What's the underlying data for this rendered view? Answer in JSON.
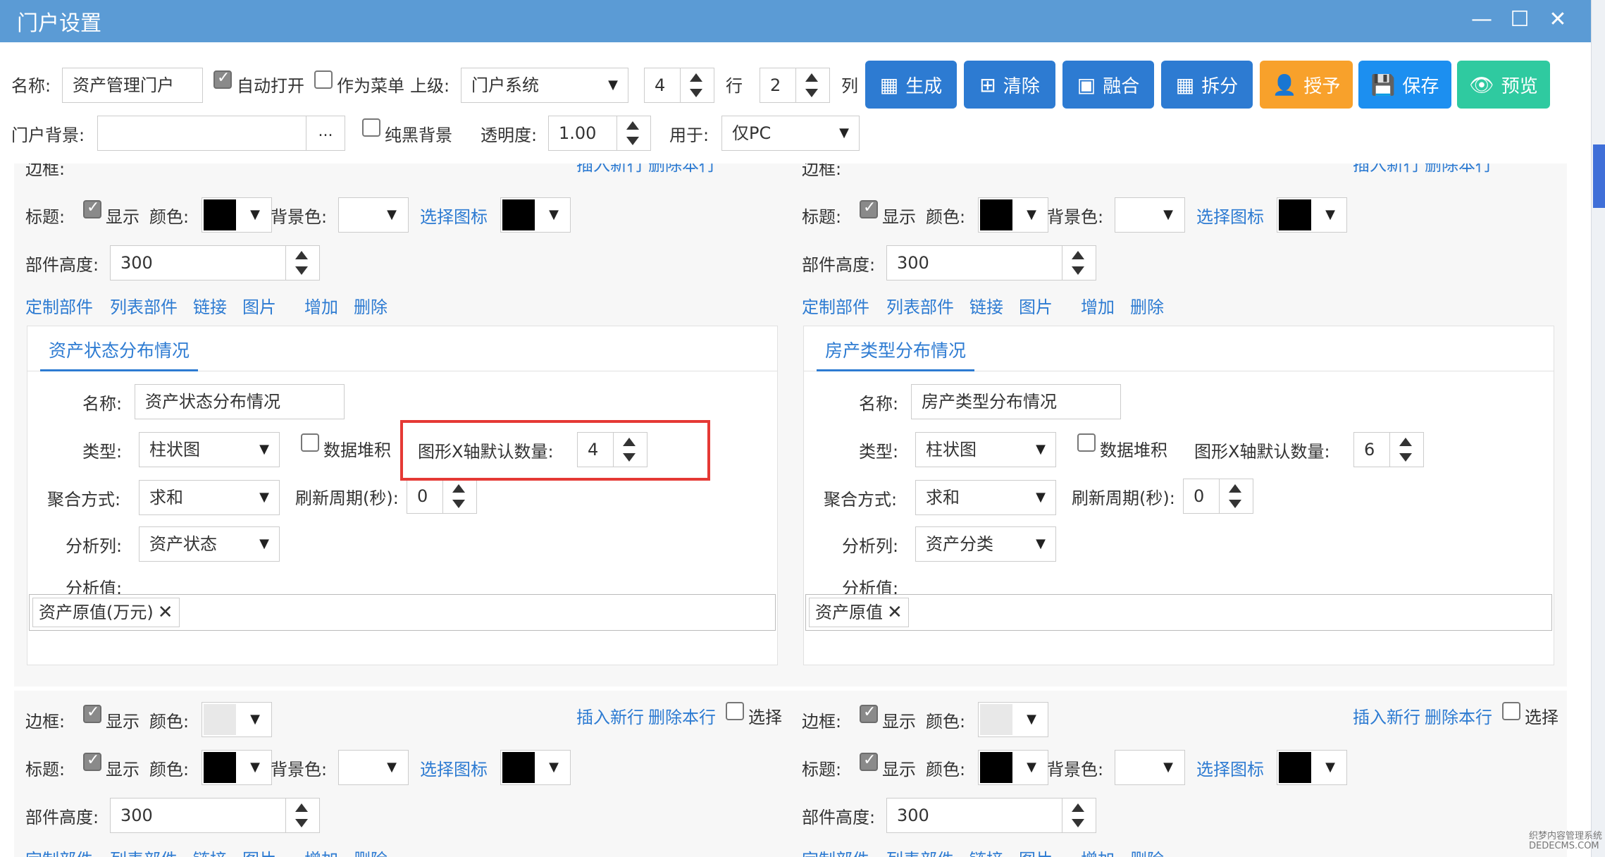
{
  "window": {
    "title": "门户设置",
    "minimize": "—",
    "maximize": "☐",
    "close": "✕"
  },
  "toolbar": {
    "name_label": "名称:",
    "name_value": "资产管理门户",
    "auto_open_label": "自动打开",
    "auto_open_checked": true,
    "as_menu_label": "作为菜单",
    "as_menu_checked": false,
    "parent_label": "上级:",
    "parent_value": "门户系统",
    "rows_value": "4",
    "rows_label": "行",
    "cols_value": "2",
    "cols_label": "列",
    "bg_label": "门户背景:",
    "bg_value": "",
    "bg_button": "...",
    "pure_black_label": "纯黑背景",
    "pure_black_checked": false,
    "opacity_label": "透明度:",
    "opacity_value": "1.00",
    "use_for_label": "用于:",
    "use_for_value": "仅PC",
    "buttons": {
      "generate": "生成",
      "clear": "清除",
      "merge": "融合",
      "split": "拆分",
      "grant": "授予",
      "save": "保存",
      "preview": "预览"
    }
  },
  "labels": {
    "border": "边框:",
    "show": "显示",
    "color": "颜色:",
    "title": "标题:",
    "bg_color": "背景色:",
    "choose_icon": "选择图标",
    "height": "部件高度:",
    "custom": "定制部件",
    "list": "列表部件",
    "link": "链接",
    "picture": "图片",
    "add": "增加",
    "delete": "删除",
    "insert_row": "插入新行",
    "delete_row": "删除本行",
    "select": "选择",
    "card_name": "名称:",
    "type": "类型:",
    "stack": "数据堆积",
    "x_axis_count": "图形X轴默认数量:",
    "agg": "聚合方式:",
    "refresh": "刷新周期(秒):",
    "analysis_col": "分析列:",
    "analysis_val": "分析值:"
  },
  "panels": [
    {
      "height": "300",
      "border_color": "#e8e8e8",
      "title_color": "#000000",
      "title_bg": "#ffffff",
      "icon_color": "#000000",
      "card": {
        "tab": "资产状态分布情况",
        "name": "资产状态分布情况",
        "type": "柱状图",
        "x_count": "4",
        "agg": "求和",
        "refresh": "0",
        "analysis_col": "资产状态",
        "analysis_value": "资产原值(万元)"
      }
    },
    {
      "height": "300",
      "border_color": "#e8e8e8",
      "title_color": "#000000",
      "title_bg": "#ffffff",
      "icon_color": "#000000",
      "card": {
        "tab": "房产类型分布情况",
        "name": "房产类型分布情况",
        "type": "柱状图",
        "x_count": "6",
        "agg": "求和",
        "refresh": "0",
        "analysis_col": "资产分类",
        "analysis_value": "资产原值"
      }
    },
    {
      "height": "300"
    },
    {
      "height": "300"
    }
  ],
  "watermark": [
    "织梦内容管理系统",
    "DEDECMS.COM"
  ]
}
